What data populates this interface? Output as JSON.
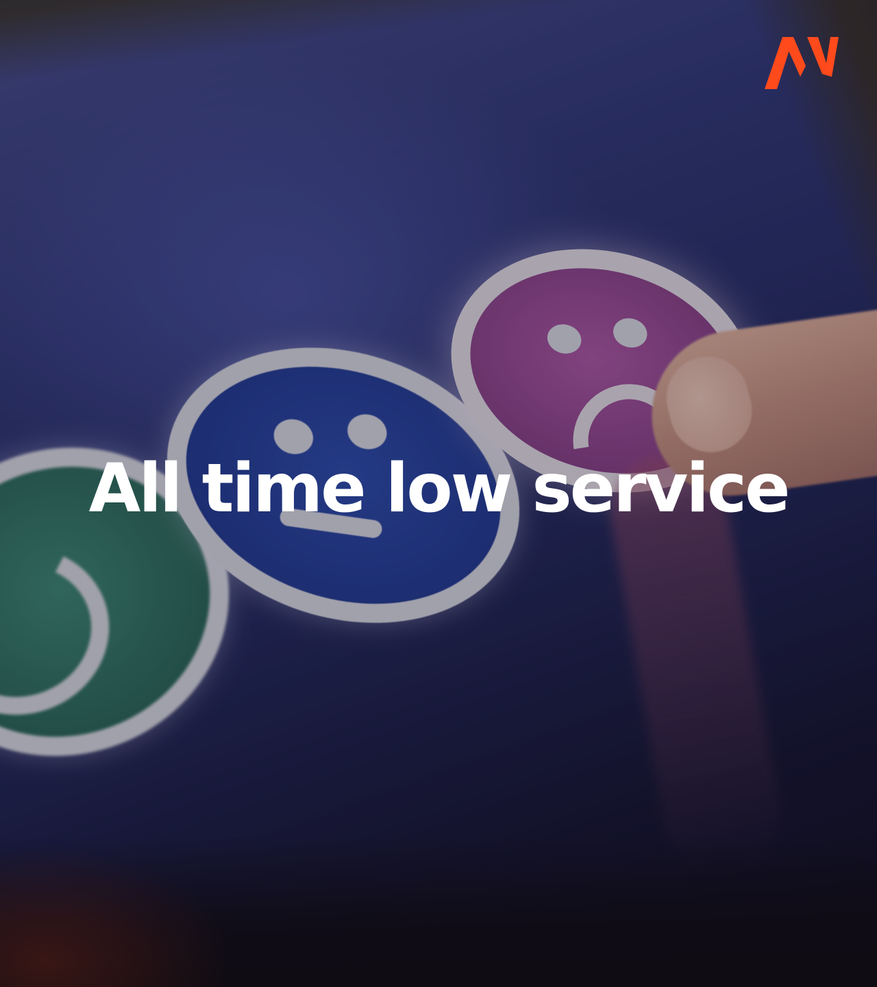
{
  "headline": "All time low service",
  "logo": {
    "icon": "av-logo-icon",
    "color": "#ff4a1c"
  },
  "faces": [
    {
      "icon": "happy-face-icon",
      "color": "#2f7a68"
    },
    {
      "icon": "neutral-face-icon",
      "color": "#2a45a0"
    },
    {
      "icon": "sad-face-icon",
      "color": "#9a4a96"
    }
  ]
}
